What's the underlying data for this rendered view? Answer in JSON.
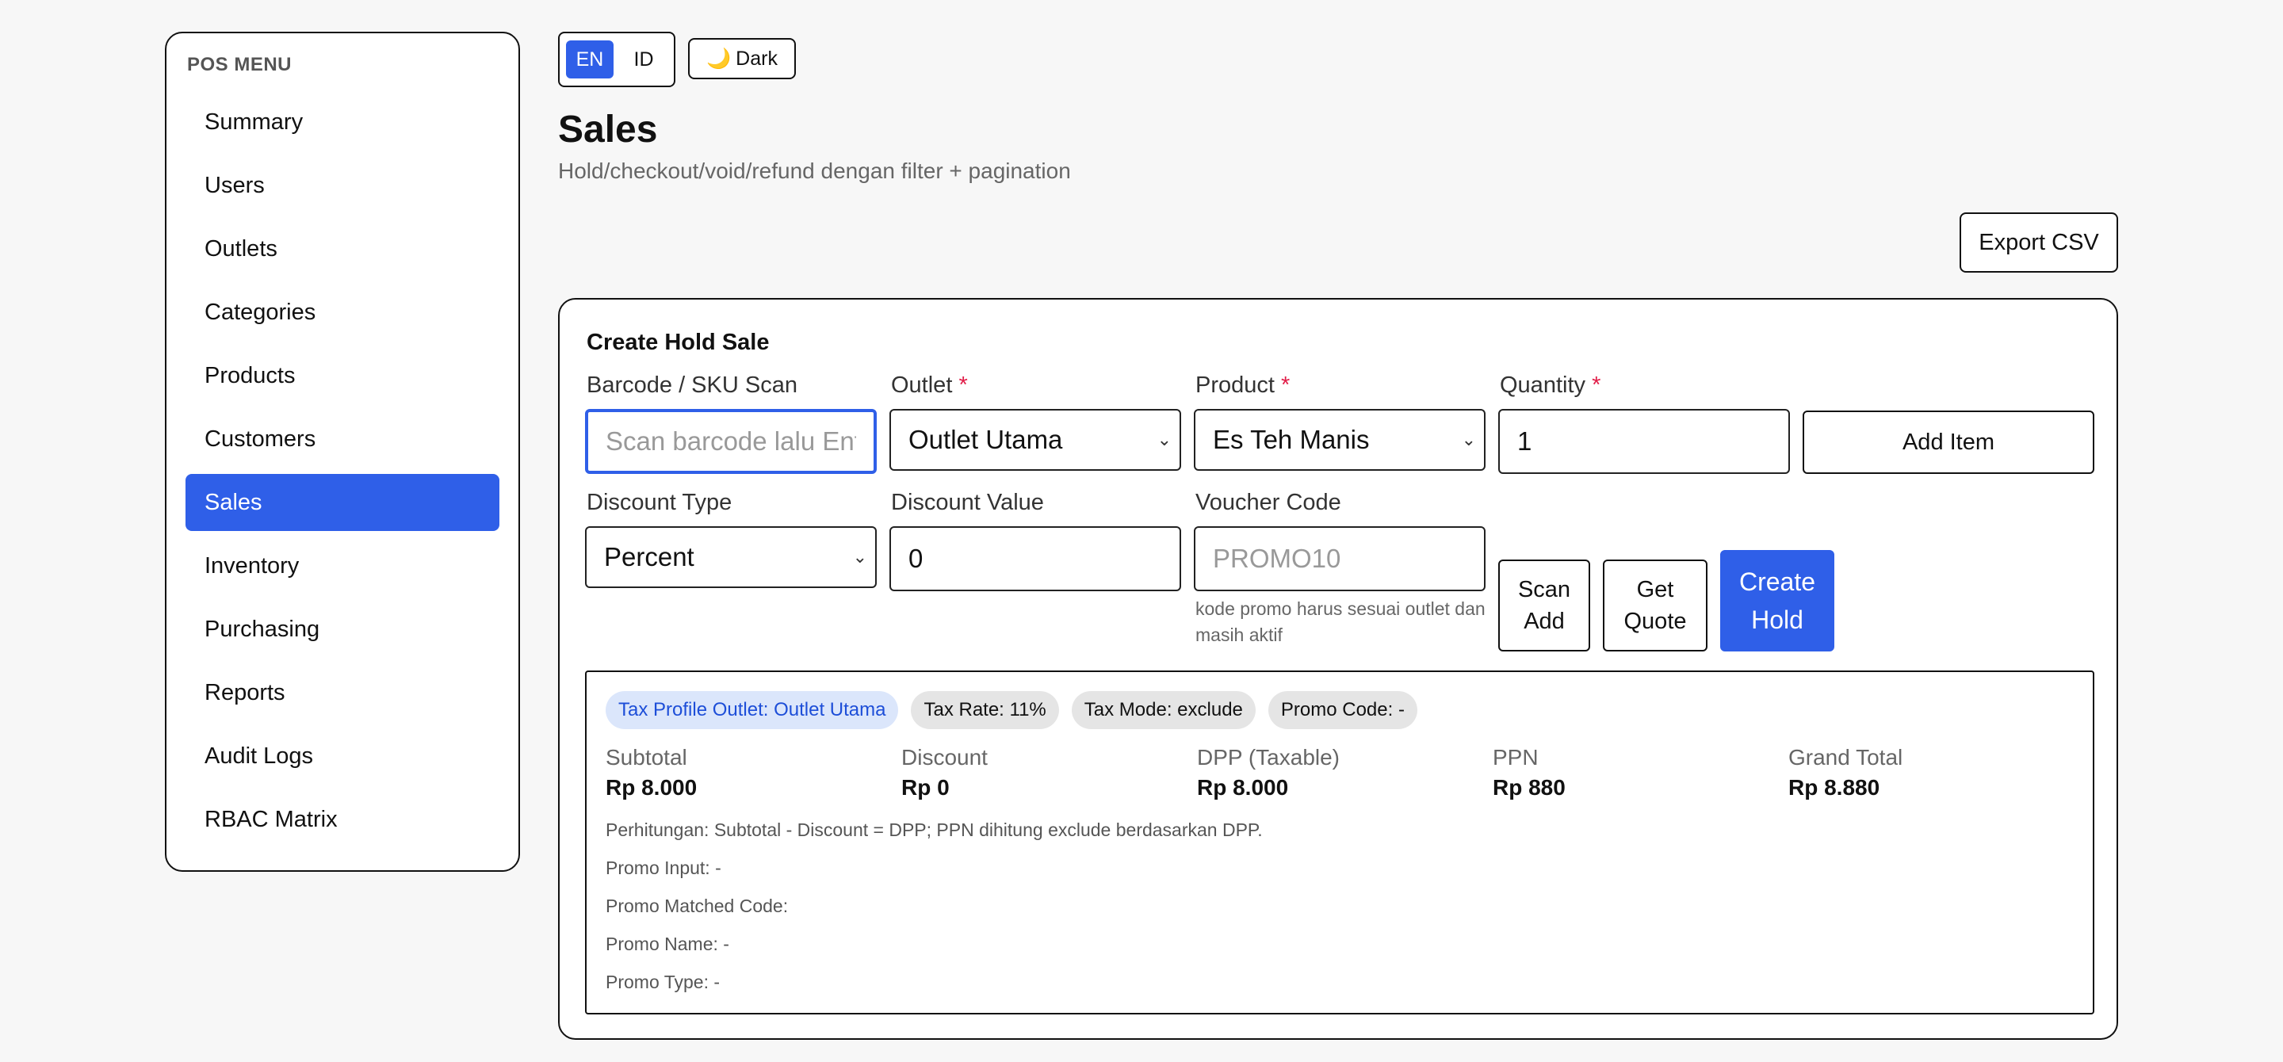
{
  "sidebar": {
    "heading": "POS MENU",
    "items": [
      {
        "label": "Summary"
      },
      {
        "label": "Users"
      },
      {
        "label": "Outlets"
      },
      {
        "label": "Categories"
      },
      {
        "label": "Products"
      },
      {
        "label": "Customers"
      },
      {
        "label": "Sales",
        "active": true
      },
      {
        "label": "Inventory"
      },
      {
        "label": "Purchasing"
      },
      {
        "label": "Reports"
      },
      {
        "label": "Audit Logs"
      },
      {
        "label": "RBAC Matrix"
      }
    ]
  },
  "topbar": {
    "lang_en": "EN",
    "lang_id": "ID",
    "dark_icon": "🌙",
    "dark_label": "Dark"
  },
  "page": {
    "title": "Sales",
    "subtitle": "Hold/checkout/void/refund dengan filter + pagination",
    "export_label": "Export CSV"
  },
  "form": {
    "title": "Create Hold Sale",
    "barcode_label": "Barcode / SKU Scan",
    "barcode_placeholder": "Scan barcode lalu Ent",
    "outlet_label": "Outlet",
    "outlet_value": "Outlet Utama",
    "product_label": "Product",
    "product_value": "Es Teh Manis",
    "quantity_label": "Quantity",
    "quantity_value": "1",
    "required_mark": "*",
    "add_item_label": "Add Item",
    "discount_type_label": "Discount Type",
    "discount_type_value": "Percent",
    "discount_value_label": "Discount Value",
    "discount_value": "0",
    "voucher_label": "Voucher Code",
    "voucher_placeholder": "PROMO10",
    "voucher_hint": "kode promo harus sesuai outlet dan masih aktif",
    "scan_add_label_1": "Scan",
    "scan_add_label_2": "Add",
    "get_quote_label_1": "Get",
    "get_quote_label_2": "Quote",
    "create_hold_label_1": "Create",
    "create_hold_label_2": "Hold"
  },
  "summary": {
    "badges": [
      {
        "text": "Tax Profile Outlet: Outlet Utama",
        "tone": "blue"
      },
      {
        "text": "Tax Rate: 11%"
      },
      {
        "text": "Tax Mode: exclude"
      },
      {
        "text": "Promo Code: -"
      }
    ],
    "metrics": [
      {
        "label": "Subtotal",
        "value": "Rp 8.000"
      },
      {
        "label": "Discount",
        "value": "Rp 0"
      },
      {
        "label": "DPP (Taxable)",
        "value": "Rp 8.000"
      },
      {
        "label": "PPN",
        "value": "Rp 880"
      },
      {
        "label": "Grand Total",
        "value": "Rp 8.880"
      }
    ],
    "notes": [
      "Perhitungan: Subtotal - Discount = DPP; PPN dihitung exclude berdasarkan DPP.",
      "Promo Input: -",
      "Promo Matched Code:",
      "Promo Name: -",
      "Promo Type: -"
    ]
  },
  "colors": {
    "accent": "#2f5fe8",
    "required": "#e11d48"
  }
}
